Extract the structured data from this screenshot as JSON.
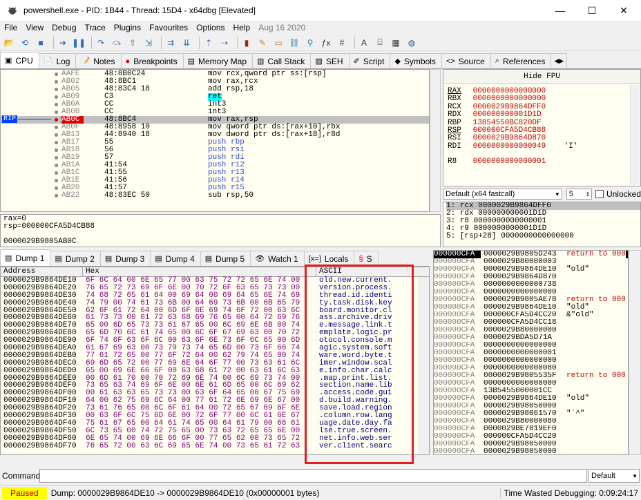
{
  "window": {
    "title": "powershell.exe - PID: 1B44 - Thread: 15D4 - x64dbg [Elevated]",
    "minimize": "—",
    "maximize": "☐",
    "close": "✕"
  },
  "menu": [
    "File",
    "View",
    "Debug",
    "Trace",
    "Plugins",
    "Favourites",
    "Options",
    "Help",
    "Aug 16 2020"
  ],
  "cpu_tabs": [
    {
      "label": "CPU",
      "icon": "cpu-icon"
    },
    {
      "label": "Log",
      "icon": "log-icon"
    },
    {
      "label": "Notes",
      "icon": "notes-icon"
    },
    {
      "label": "Breakpoints",
      "icon": "breakpoint-icon"
    },
    {
      "label": "Memory Map",
      "icon": "memory-icon"
    },
    {
      "label": "Call Stack",
      "icon": "callstack-icon"
    },
    {
      "label": "SEH",
      "icon": "seh-icon"
    },
    {
      "label": "Script",
      "icon": "script-icon"
    },
    {
      "label": "Symbols",
      "icon": "symbols-icon"
    },
    {
      "label": "Source",
      "icon": "source-icon"
    },
    {
      "label": "References",
      "icon": "references-icon"
    }
  ],
  "disasm": {
    "rip_label": "RIP",
    "rows": [
      {
        "addr": "AAFE",
        "bytes": "48:8B0C24",
        "asm": "mov rcx,qword ptr ss:[rsp]"
      },
      {
        "addr": "AB02",
        "bytes": "48:8BC1",
        "asm": "mov rax,rcx"
      },
      {
        "addr": "AB05",
        "bytes": "48:83C4 18",
        "asm": "add rsp,18"
      },
      {
        "addr": "AB09",
        "bytes": "C3",
        "asm": "ret"
      },
      {
        "addr": "AB0A",
        "bytes": "CC",
        "asm": "int3"
      },
      {
        "addr": "AB0B",
        "bytes": "CC",
        "asm": "int3"
      },
      {
        "addr": "AB0C",
        "bytes": "48:8BC4",
        "asm": "mov rax,rsp"
      },
      {
        "addr": "AB0F",
        "bytes": "48:8958 10",
        "asm": "mov qword ptr ds:[rax+10],rbx"
      },
      {
        "addr": "AB13",
        "bytes": "44:8940 18",
        "asm": "mov dword ptr ds:[rax+18],r8d"
      },
      {
        "addr": "AB17",
        "bytes": "55",
        "asm": "push rbp"
      },
      {
        "addr": "AB18",
        "bytes": "56",
        "asm": "push rsi"
      },
      {
        "addr": "AB19",
        "bytes": "57",
        "asm": "push rdi"
      },
      {
        "addr": "AB1A",
        "bytes": "41:54",
        "asm": "push r12"
      },
      {
        "addr": "AB1C",
        "bytes": "41:55",
        "asm": "push r13"
      },
      {
        "addr": "AB1E",
        "bytes": "41:56",
        "asm": "push r14"
      },
      {
        "addr": "AB20",
        "bytes": "41:57",
        "asm": "push r15"
      },
      {
        "addr": "AB22",
        "bytes": "48:83EC 50",
        "asm": "sub rsp,50"
      }
    ]
  },
  "info_lines": [
    "rax=0",
    "rsp=000000CFA5D4CB88",
    "",
    "0000029B9805AB0C"
  ],
  "registers": {
    "hide_fpu": "Hide FPU",
    "rows": [
      {
        "name": "RAX",
        "value": "0000000000000000",
        "comment": ""
      },
      {
        "name": "RBX",
        "value": "0000000000000000",
        "comment": ""
      },
      {
        "name": "RCX",
        "value": "0000029B9864DFF0",
        "comment": ""
      },
      {
        "name": "RDX",
        "value": "000000000001D1D",
        "comment": ""
      },
      {
        "name": "RBP",
        "value": "13854550BC820DF",
        "comment": ""
      },
      {
        "name": "RSP",
        "value": "000000CFA5D4CB88",
        "comment": ""
      },
      {
        "name": "RSI",
        "value": "0000029B9864D870",
        "comment": ""
      },
      {
        "name": "RDI",
        "value": "0000000000000049",
        "comment": "'I'"
      },
      {
        "name": "",
        "value": "",
        "comment": ""
      },
      {
        "name": "R8",
        "value": "0000000000000001",
        "comment": ""
      }
    ]
  },
  "callconv": {
    "selected": "Default (x64 fastcall)",
    "count": "5",
    "unlocked_label": "Unlocked"
  },
  "args": [
    "1: rcx 0000029B9864DFF0",
    "2: rdx 000000000001D1D",
    "3: r8 0000000000000001",
    "4: r9 0000000000001D1D",
    "5: [rsp+28] 0000000000000000"
  ],
  "dump_tabs": [
    {
      "label": "Dump 1",
      "icon": "dump-icon"
    },
    {
      "label": "Dump 2",
      "icon": "dump-icon"
    },
    {
      "label": "Dump 3",
      "icon": "dump-icon"
    },
    {
      "label": "Dump 4",
      "icon": "dump-icon"
    },
    {
      "label": "Dump 5",
      "icon": "dump-icon"
    },
    {
      "label": "Watch 1",
      "icon": "watch-icon"
    },
    {
      "label": "Locals",
      "icon": "locals-icon"
    },
    {
      "label": "S",
      "icon": "struct-icon"
    }
  ],
  "dump": {
    "headers": [
      "Address",
      "Hex",
      "ASCII"
    ],
    "rows": [
      {
        "a": "0000029B9864DE10",
        "h": "6F 6C 64 00 6E 65 77 00 63 75 72 72 65 6E 74 00",
        "s": "old.new.current."
      },
      {
        "a": "0000029B9864DE20",
        "h": "76 65 72 73 69 6F 6E 00 70 72 6F 63 65 73 73 00",
        "s": "version.process."
      },
      {
        "a": "0000029B9864DE30",
        "h": "74 68 72 65 61 64 00 69 64 00 69 64 65 6E 74 69",
        "s": "thread.id.identi"
      },
      {
        "a": "0000029B9864DE40",
        "h": "74 79 00 74 61 73 6B 00 64 69 73 6B 00 6B 65 79",
        "s": "ty.task.disk.key"
      },
      {
        "a": "0000029B9864DE50",
        "h": "62 6F 61 72 64 00 6D 6F 6E 69 74 6F 72 00 63 6C",
        "s": "board.monitor.cl"
      },
      {
        "a": "0000029B9864DE60",
        "h": "61 73 73 00 61 72 63 68 69 76 65 00 64 72 69 76",
        "s": "ass.archive.driv"
      },
      {
        "a": "0000029B9864DE70",
        "h": "65 00 6D 65 73 73 61 67 65 00 6C 69 6E 6B 00 74",
        "s": "e.message.link.t"
      },
      {
        "a": "0000029B9864DE80",
        "h": "65 6D 70 6C 61 74 65 00 6C 6F 67 69 63 00 70 72",
        "s": "emplate.logic.pr"
      },
      {
        "a": "0000029B9864DE90",
        "h": "6F 74 6F 63 6F 6C 00 63 6F 6E 73 6F 6C 65 00 6D",
        "s": "otocol.console.m"
      },
      {
        "a": "0000029B9864DEA0",
        "h": "61 67 69 63 00 73 79 73 74 65 6D 00 73 6F 66 74",
        "s": "agic.system.soft"
      },
      {
        "a": "0000029B9864DEB0",
        "h": "77 61 72 65 00 77 6F 72 64 00 62 79 74 65 00 74",
        "s": "ware.word.byte.t"
      },
      {
        "a": "0000029B9864DEC0",
        "h": "69 6D 65 72 00 77 69 6E 64 6F 77 00 73 63 61 6C",
        "s": "imer.window.scal"
      },
      {
        "a": "0000029B9864DED0",
        "h": "65 00 69 6E 66 6F 00 63 68 61 72 00 63 61 6C 63",
        "s": "e.info.char.calc"
      },
      {
        "a": "0000029B9864DEE0",
        "h": "00 6D 61 70 00 70 72 69 6E 74 00 6C 69 73 74 00",
        "s": ".map.print.list."
      },
      {
        "a": "0000029B9864DEF0",
        "h": "73 65 63 74 69 6F 6E 00 6E 61 6D 65 00 6C 69 62",
        "s": "section.name.lib"
      },
      {
        "a": "0000029B9864DF00",
        "h": "00 61 63 63 65 73 73 00 63 6F 64 65 00 67 75 69",
        "s": ".access.code.gui"
      },
      {
        "a": "0000029B9864DF10",
        "h": "64 00 62 75 69 6C 64 00 77 61 72 6E 69 6E 67 00",
        "s": "d.build.warning."
      },
      {
        "a": "0000029B9864DF20",
        "h": "73 61 76 65 00 6C 6F 61 64 00 72 65 67 69 6F 6E",
        "s": "save.load.region"
      },
      {
        "a": "0000029B9864DF30",
        "h": "00 63 6F 6C 75 6D 6E 00 72 6F 77 00 6C 61 6E 67",
        "s": ".column.row.lang"
      },
      {
        "a": "0000029B9864DF40",
        "h": "75 61 67 65 00 64 61 74 65 00 64 61 79 00 66 61",
        "s": "uage.date.day.fa"
      },
      {
        "a": "0000029B9864DF50",
        "h": "6C 73 65 00 74 72 75 65 00 73 63 72 65 65 6E 00",
        "s": "lse.true.screen."
      },
      {
        "a": "0000029B9864DF60",
        "h": "6E 65 74 00 69 6E 66 6F 00 77 65 62 00 73 65 72",
        "s": "net.info.web.ser"
      },
      {
        "a": "0000029B9864DF70",
        "h": "76 65 72 00 63 6C 69 65 6E 74 00 73 65 61 72 63",
        "s": "ver.client.searc"
      }
    ]
  },
  "stack": {
    "rows": [
      {
        "a": "000000CFA",
        "v": "0000029B9805D243",
        "c": "return to 000",
        "ret": true
      },
      {
        "a": "000000CFA",
        "v": "0000029B80000003",
        "c": ""
      },
      {
        "a": "000000CFA",
        "v": "0000029B9864DE10",
        "c": "\"old\""
      },
      {
        "a": "000000CFA",
        "v": "0000029B9864D870",
        "c": ""
      },
      {
        "a": "000000CFA",
        "v": "0000000000000738",
        "c": ""
      },
      {
        "a": "000000CFA",
        "v": "0000000000000000",
        "c": ""
      },
      {
        "a": "000000CFA",
        "v": "0000029B9805AE78",
        "c": "return to 000",
        "ret": true
      },
      {
        "a": "000000CFA",
        "v": "0000029B9864DE10",
        "c": "\"old\""
      },
      {
        "a": "000000CFA",
        "v": "000000CFA5D4CC20",
        "c": "&\"old\""
      },
      {
        "a": "000000CFA",
        "v": "000000CFA5D4CC18",
        "c": ""
      },
      {
        "a": "000000CFA",
        "v": "0000029B80000000",
        "c": ""
      },
      {
        "a": "000000CFA",
        "v": "0000029BDA5D71A",
        "c": ""
      },
      {
        "a": "000000CFA",
        "v": "0000000000000000",
        "c": ""
      },
      {
        "a": "000000CFA",
        "v": "0000000000000001",
        "c": ""
      },
      {
        "a": "000000CFA",
        "v": "0000000000000000",
        "c": ""
      },
      {
        "a": "000000CFA",
        "v": "0000000000000080",
        "c": ""
      },
      {
        "a": "000000CFA",
        "v": "0000029B9805535F",
        "c": "return to 000",
        "ret": true
      },
      {
        "a": "000000CFA",
        "v": "0000000000000000",
        "c": ""
      },
      {
        "a": "000000CFA",
        "v": "13B5455000001CC",
        "c": ""
      },
      {
        "a": "000000CFA",
        "v": "0000029B9864DE10",
        "c": "\"old\""
      },
      {
        "a": "000000CFA",
        "v": "0000029B98050000",
        "c": ""
      },
      {
        "a": "000000CFA",
        "v": "0000029B98061570",
        "c": "\"`^\""
      },
      {
        "a": "000000CFA",
        "v": "0000029B80000080",
        "c": ""
      },
      {
        "a": "000000CFA",
        "v": "0000029BE7019EF0",
        "c": ""
      },
      {
        "a": "000000CFA",
        "v": "000000CFA5D4CC20",
        "c": ""
      },
      {
        "a": "000000CFA",
        "v": "0000029B98050000",
        "c": ""
      },
      {
        "a": "000000CFA",
        "v": "0000029B98050000",
        "c": ""
      }
    ]
  },
  "command": {
    "label": "Command:",
    "value": "",
    "mode": "Default"
  },
  "status": {
    "state": "Paused",
    "message": "Dump: 0000029B9864DE10 -> 0000029B9864DE10 (0x00000001 bytes)",
    "time": "Time Wasted Debugging: 0:09:24:17"
  },
  "colors": {
    "highlight": "#e02020",
    "paused_bg": "#ffff00"
  }
}
